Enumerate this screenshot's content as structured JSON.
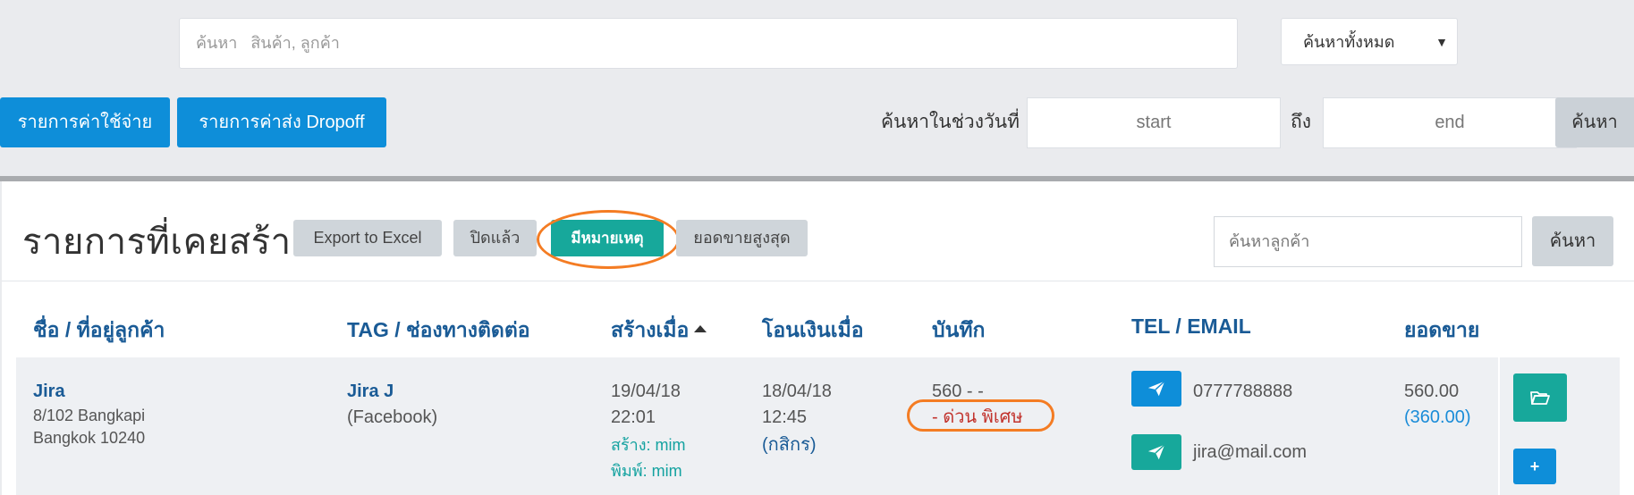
{
  "search": {
    "placeholder": "ค้นหา   สินค้า, ลูกค้า"
  },
  "scope": {
    "selected": "ค้นหาทั้งหมด"
  },
  "buttons": {
    "expenses": "รายการค่าใช้จ่าย",
    "dropoff": "รายการค่าส่ง Dropoff",
    "search": "ค้นหา"
  },
  "date_range": {
    "label": "ค้นหาในช่วงวันที่",
    "start_placeholder": "start",
    "to_label": "ถึง",
    "end_placeholder": "end"
  },
  "panel": {
    "title": "รายการที่เคยสร้าง",
    "filters": [
      "Export to Excel",
      "ปิดแล้ว",
      "มีหมายเหตุ",
      "ยอดขายสูงสุด"
    ],
    "customer_search_placeholder": "ค้นหาลูกค้า",
    "customer_search_button": "ค้นหา"
  },
  "table": {
    "headers": [
      "ชื่อ / ที่อยู่ลูกค้า",
      "TAG / ช่องทางติดต่อ",
      "สร้างเมื่อ",
      "โอนเงินเมื่อ",
      "บันทึก",
      "TEL / EMAIL",
      "ยอดขาย"
    ],
    "sorted_column": "สร้างเมื่อ",
    "rows": [
      {
        "name": "Jira",
        "address_line1": "8/102 Bangkapi",
        "address_line2": "Bangkok 10240",
        "tag": "Jira J",
        "channel": "(Facebook)",
        "created_date": "19/04/18",
        "created_time": "22:01",
        "created_by": "สร้าง: mim",
        "printed_by": "พิมพ์: mim",
        "paid_date": "18/04/18",
        "paid_time": "12:45",
        "paid_bank": "(กสิกร)",
        "note_line1": "560 - -",
        "note_line2": "- ด่วน พิเศษ",
        "tel": "0777788888",
        "email": "jira@mail.com",
        "sales_total": "560.00",
        "sales_sub": "(360.00)"
      }
    ]
  },
  "colors": {
    "primary": "#0e8ed9",
    "teal": "#17a89b",
    "highlight": "#f47c23",
    "header_text": "#1a5b96"
  },
  "icons": [
    "caret-down-icon",
    "send-icon",
    "folder-open-icon",
    "plus-icon",
    "sort-asc-icon"
  ]
}
